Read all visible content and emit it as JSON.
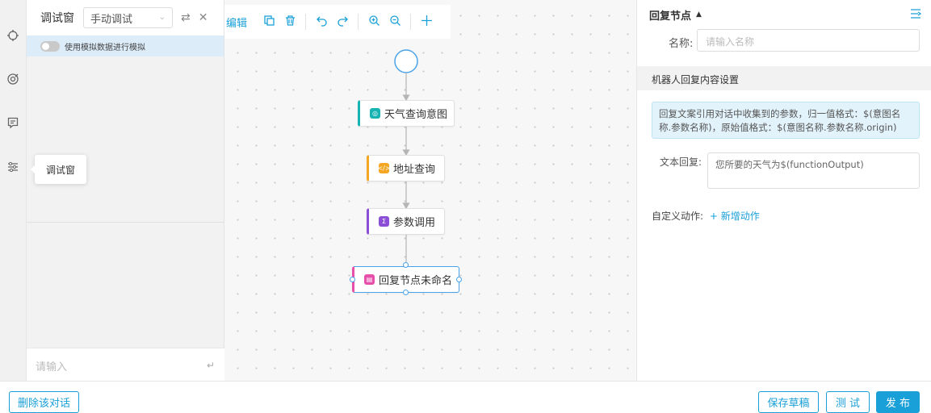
{
  "debug": {
    "title": "调试窗",
    "mode": "手动调试",
    "toggle_label": "使用模拟数据进行模拟",
    "input_placeholder": "请输入"
  },
  "tooltip": "调试窗",
  "toolbar": {
    "edit_label": "编辑"
  },
  "flow": {
    "nodes": [
      {
        "label": "天气查询意图",
        "icon": "intent-icon",
        "color": "#17b3b3"
      },
      {
        "label": "地址查询",
        "icon": "code-icon",
        "color": "#f5a623"
      },
      {
        "label": "参数调用",
        "icon": "sigma-icon",
        "color": "#8a4fd6"
      },
      {
        "label": "回复节点未命名",
        "icon": "reply-icon",
        "color": "#e64faa"
      }
    ]
  },
  "panel": {
    "title": "回复节点",
    "name_label": "名称:",
    "name_placeholder": "请输入名称",
    "section_title": "机器人回复内容设置",
    "info": "回复文案引用对话中收集到的参数，归一值格式：$(意图名称.参数名称)，原始值格式：$(意图名称.参数名称.origin)",
    "reply_label": "文本回复:",
    "reply_value": "您所要的天气为$(functionOutput)",
    "action_label": "自定义动作:",
    "action_link": "+ 新增动作"
  },
  "footer": {
    "delete_label": "删除该对话",
    "save_label": "保存草稿",
    "test_label": "测 试",
    "publish_label": "发 布"
  },
  "colors": {
    "accent": "#1aa0d8"
  }
}
